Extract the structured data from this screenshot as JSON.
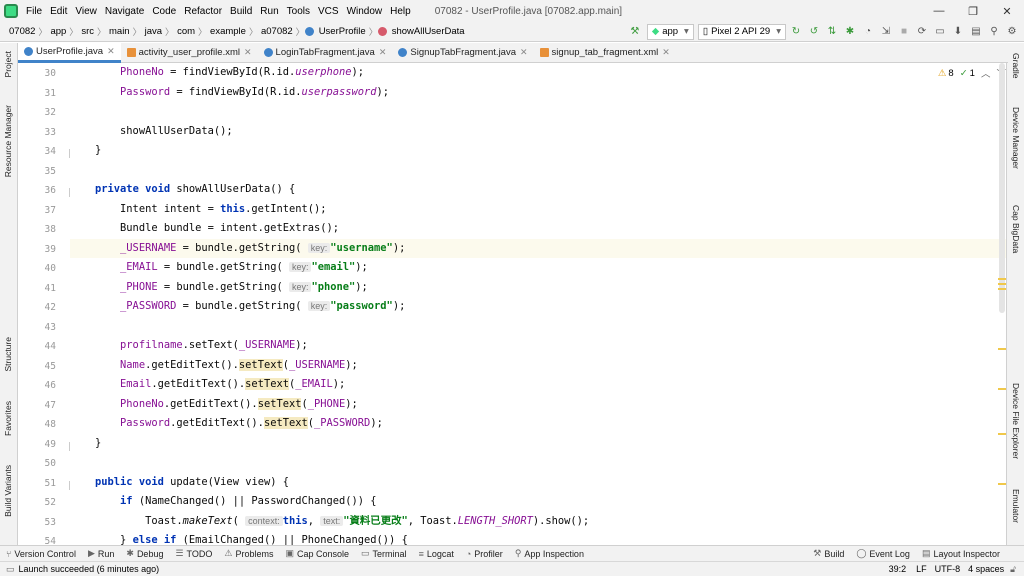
{
  "menu": {
    "items": [
      "File",
      "Edit",
      "View",
      "Navigate",
      "Code",
      "Refactor",
      "Build",
      "Run",
      "Tools",
      "VCS",
      "Window",
      "Help"
    ],
    "title": "07082 - UserProfile.java [07082.app.main]"
  },
  "nav": {
    "crumbs": [
      "07082",
      "app",
      "src",
      "main",
      "java",
      "com",
      "example",
      "a07082",
      "UserProfile",
      "showAllUserData"
    ],
    "run_config": "app",
    "device": "Pixel 2 API 29"
  },
  "tabs": [
    {
      "label": "UserProfile.java",
      "color": "#4083c9"
    },
    {
      "label": "activity_user_profile.xml",
      "color": "#e8913a"
    },
    {
      "label": "LoginTabFragment.java",
      "color": "#4083c9"
    },
    {
      "label": "SignupTabFragment.java",
      "color": "#4083c9"
    },
    {
      "label": "signup_tab_fragment.xml",
      "color": "#e8913a"
    }
  ],
  "left_tools": [
    "Project",
    "Resource Manager",
    "Structure",
    "Favorites",
    "Build Variants"
  ],
  "right_tools": [
    "Gradle",
    "Device Manager",
    "Cap BigData",
    "Device File Explorer",
    "Emulator"
  ],
  "inspection": {
    "warnings": "8",
    "weak": "1"
  },
  "line_numbers": [
    "30",
    "31",
    "32",
    "33",
    "34",
    "35",
    "36",
    "37",
    "38",
    "39",
    "40",
    "41",
    "42",
    "43",
    "44",
    "45",
    "46",
    "47",
    "48",
    "49",
    "50",
    "51",
    "52",
    "53",
    "54"
  ],
  "code": {
    "l30": {
      "a": "        ",
      "b": "PhoneNo",
      "c": " = findViewById(R.id.",
      "d": "userphone",
      "e": ");"
    },
    "l31": {
      "a": "        ",
      "b": "Password",
      "c": " = findViewById(R.id.",
      "d": "userpassword",
      "e": ");"
    },
    "l33": {
      "a": "        showAllUserData();"
    },
    "l34": {
      "a": "    }"
    },
    "l36": {
      "kw1": "private",
      "kw2": "void",
      "rest": " showAllUserData() {"
    },
    "l37": {
      "a": "        Intent intent = ",
      "kw": "this",
      "b": ".getIntent();"
    },
    "l38": {
      "a": "        Bundle bundle = intent.getExtras();"
    },
    "l39": {
      "f": "_USERNAME",
      "a": " = bundle.getString( ",
      "hint": "key:",
      "s": "\"username\"",
      "e": ");"
    },
    "l40": {
      "f": "_EMAIL",
      "a": " = bundle.getString( ",
      "hint": "key:",
      "s": "\"email\"",
      "e": ");"
    },
    "l41": {
      "f": "_PHONE",
      "a": " = bundle.getString( ",
      "hint": "key:",
      "s": "\"phone\"",
      "e": ");"
    },
    "l42": {
      "f": "_PASSWORD",
      "a": " = bundle.getString( ",
      "hint": "key:",
      "s": "\"password\"",
      "e": ");"
    },
    "l44": {
      "f": "profilname",
      "a": ".setText(",
      "f2": "_USERNAME",
      "e": ");"
    },
    "l45": {
      "f": "Name",
      "a": ".getEditText().",
      "m": "setText",
      "b": "(",
      "f2": "_USERNAME",
      "e": ");"
    },
    "l46": {
      "f": "Email",
      "a": ".getEditText().",
      "m": "setText",
      "b": "(",
      "f2": "_EMAIL",
      "e": ");"
    },
    "l47": {
      "f": "PhoneNo",
      "a": ".getEditText().",
      "m": "setText",
      "b": "(",
      "f2": "_PHONE",
      "e": ");"
    },
    "l48": {
      "f": "Password",
      "a": ".getEditText().",
      "m": "setText",
      "b": "(",
      "f2": "_PASSWORD",
      "e": ");"
    },
    "l49": {
      "a": "    }"
    },
    "l51": {
      "kw1": "public",
      "kw2": "void",
      "rest": " update(View view) {"
    },
    "l52": {
      "kw": "if",
      "rest": " (NameChanged() || PasswordChanged()) {"
    },
    "l53": {
      "a": "            Toast.",
      "m": "makeText",
      "b": "( ",
      "h1": "context:",
      "kw": "this",
      "c": ", ",
      "h2": "text:",
      "s": "\"資料已更改\"",
      "d": ", Toast.",
      "k": "LENGTH_SHORT",
      "e": ").show();"
    },
    "l54": {
      "a": "        } ",
      "kw": "else if",
      "rest": " (EmailChanged() || PhoneChanged()) {"
    }
  },
  "bottom_tools": [
    {
      "label": "Version Control",
      "icon": "⑂"
    },
    {
      "label": "Run",
      "icon": "▶"
    },
    {
      "label": "Debug",
      "icon": "✱"
    },
    {
      "label": "TODO",
      "icon": "☰"
    },
    {
      "label": "Problems",
      "icon": "⚠"
    },
    {
      "label": "Cap Console",
      "icon": "▣"
    },
    {
      "label": "Terminal",
      "icon": "▭"
    },
    {
      "label": "Logcat",
      "icon": "≡"
    },
    {
      "label": "Profiler",
      "icon": "◔"
    },
    {
      "label": "App Inspection",
      "icon": "⚲"
    }
  ],
  "bottom_right_tools": [
    {
      "label": "Build",
      "icon": "⚒"
    },
    {
      "label": "Event Log",
      "icon": "◯"
    },
    {
      "label": "Layout Inspector",
      "icon": "▤"
    }
  ],
  "status": {
    "message": "Launch succeeded (6 minutes ago)",
    "position": "39:2",
    "line_sep": "LF",
    "encoding": "UTF-8",
    "indent": "4 spaces"
  }
}
